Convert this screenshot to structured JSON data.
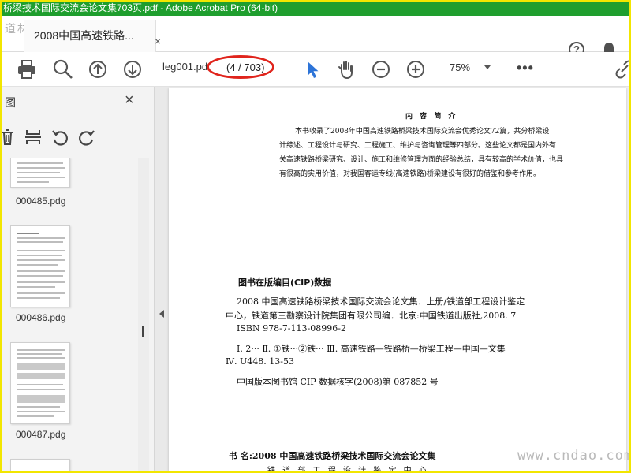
{
  "window": {
    "title": "桥梁技术国际交流会论文集703页.pdf - Adobe Acrobat Pro (64-bit)",
    "watermark_logo": "道林网"
  },
  "tab": {
    "title": "2008中国高速铁路...",
    "close": "×",
    "help_icon": "help-icon",
    "help_glyph": "?",
    "bell_icon": "bell-icon"
  },
  "toolbar": {
    "icons": [
      "print-icon",
      "zoom-search-icon",
      "page-up-icon",
      "page-down-icon",
      "select-cursor-icon",
      "hand-tool-icon",
      "zoom-out-icon",
      "zoom-in-icon",
      "link-icon"
    ],
    "file_label": "leg001.pd",
    "page_indicator": "(4 / 703)",
    "zoom": "75%",
    "more": "•••",
    "accent": "#2d74d8",
    "highlight_color": "#e0241c"
  },
  "sidebar": {
    "title": "图",
    "close": "×",
    "tools": [
      "delete-icon",
      "insert-pages-icon",
      "rotate-left-icon",
      "rotate-right-icon"
    ],
    "thumbnails": [
      {
        "label": "000485.pdg"
      },
      {
        "label": "000486.pdg"
      },
      {
        "label": "000487.pdg"
      }
    ]
  },
  "document": {
    "heading": "内 容 简 介",
    "intro": [
      "本书收录了2008年中国高速铁路桥梁技术国际交流会优秀论文72篇，共分桥梁设",
      "计综述、工程设计与研究、工程施工、维护与咨询管理等四部分。这些论文都是国内外有",
      "关高速铁路桥梁研究、设计、施工和维修管理方面的经验总结，具有较高的学术价值，也具",
      "有很高的实用价值，对我国客运专线(高速铁路)桥梁建设有很好的借鉴和参考作用。"
    ],
    "cip_heading": "图书在版编目(CIP)数据",
    "cip_lines": [
      "2008 中国高速铁路桥梁技术国际交流会论文集．上册/铁道部工程设计鉴定",
      "中心，铁道第三勘察设计院集团有限公司编．北京:中国铁道出版社,2008. 7",
      "ISBN 978-7-113-08996-2",
      "Ⅰ. 2···   Ⅱ. ①铁···②铁···   Ⅲ. 高速铁路—铁路桥—桥梁工程—中国—文集",
      "Ⅳ. U448. 13-53",
      "中国版本图书馆 CIP 数据核字(2008)第 087852 号"
    ],
    "book_title": "书    名:2008 中国高速铁路桥梁技术国际交流会论文集",
    "book_subtitle": "铁 道 部 工 程 设 计 鉴 定 中 心"
  },
  "site_watermark": "www.cndao.com"
}
